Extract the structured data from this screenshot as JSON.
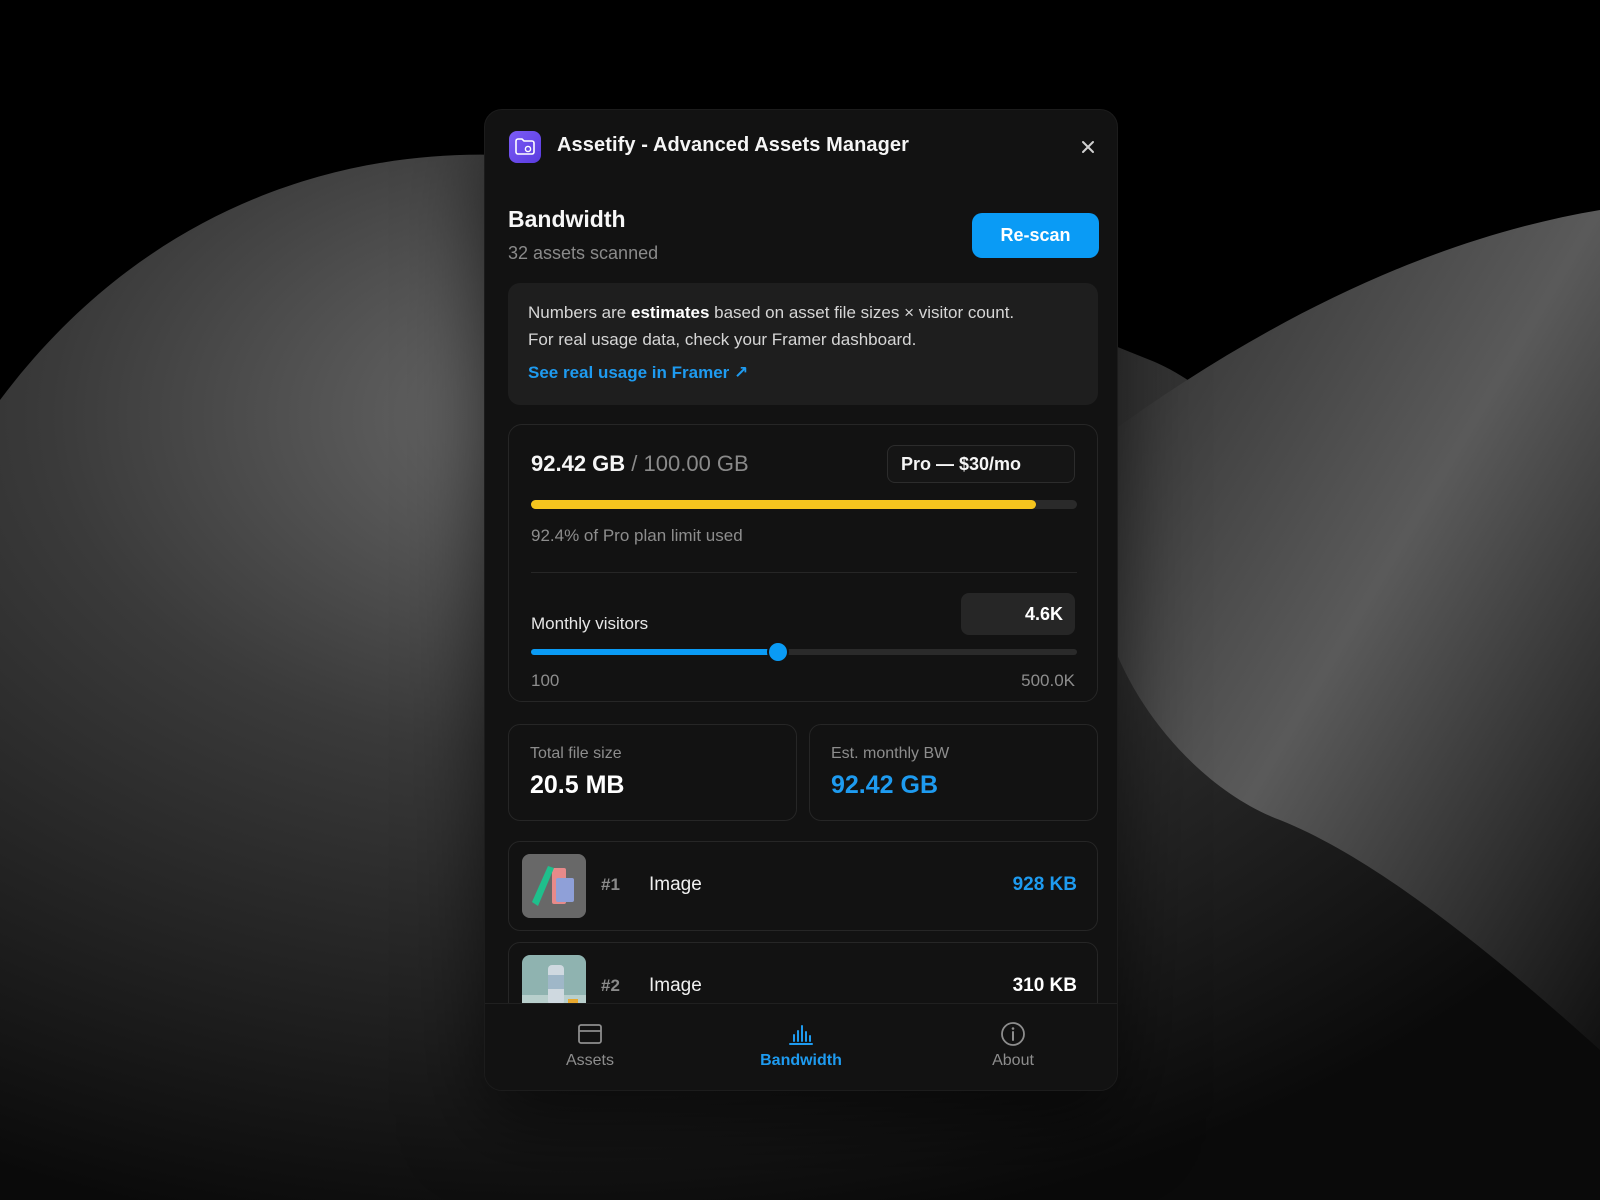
{
  "app": {
    "title": "Assetify - Advanced Assets Manager",
    "accent": "#0a9bf5"
  },
  "header": {
    "title": "Bandwidth",
    "subtitle": "32 assets scanned",
    "rescan_label": "Re-scan"
  },
  "info": {
    "line1_pre": "Numbers are ",
    "line1_bold": "estimates",
    "line1_post": " based on asset file sizes × visitor count.",
    "line2": "For real usage data, check your Framer dashboard.",
    "link": "See real usage in Framer ↗"
  },
  "usage": {
    "used": "92.42 GB",
    "separator": " / ",
    "limit": "100.00 GB",
    "plan": "Pro — $30/mo",
    "percent": 92.4,
    "percent_label": "92.4% of Pro plan limit used",
    "bar_color": "#f5c51e"
  },
  "visitors": {
    "label": "Monthly visitors",
    "value": "4.6K",
    "min": "100",
    "max": "500.0K",
    "slider_fraction": 0.452
  },
  "stats": {
    "total_label": "Total file size",
    "total_value": "20.5 MB",
    "bw_label": "Est. monthly BW",
    "bw_value": "92.42 GB"
  },
  "assets": [
    {
      "rank": "#1",
      "type": "Image",
      "size": "928 KB"
    },
    {
      "rank": "#2",
      "type": "Image",
      "size": "310 KB"
    }
  ],
  "nav": [
    {
      "label": "Assets",
      "icon": "card-icon"
    },
    {
      "label": "Bandwidth",
      "icon": "bar-chart-icon"
    },
    {
      "label": "About",
      "icon": "info-icon"
    }
  ]
}
